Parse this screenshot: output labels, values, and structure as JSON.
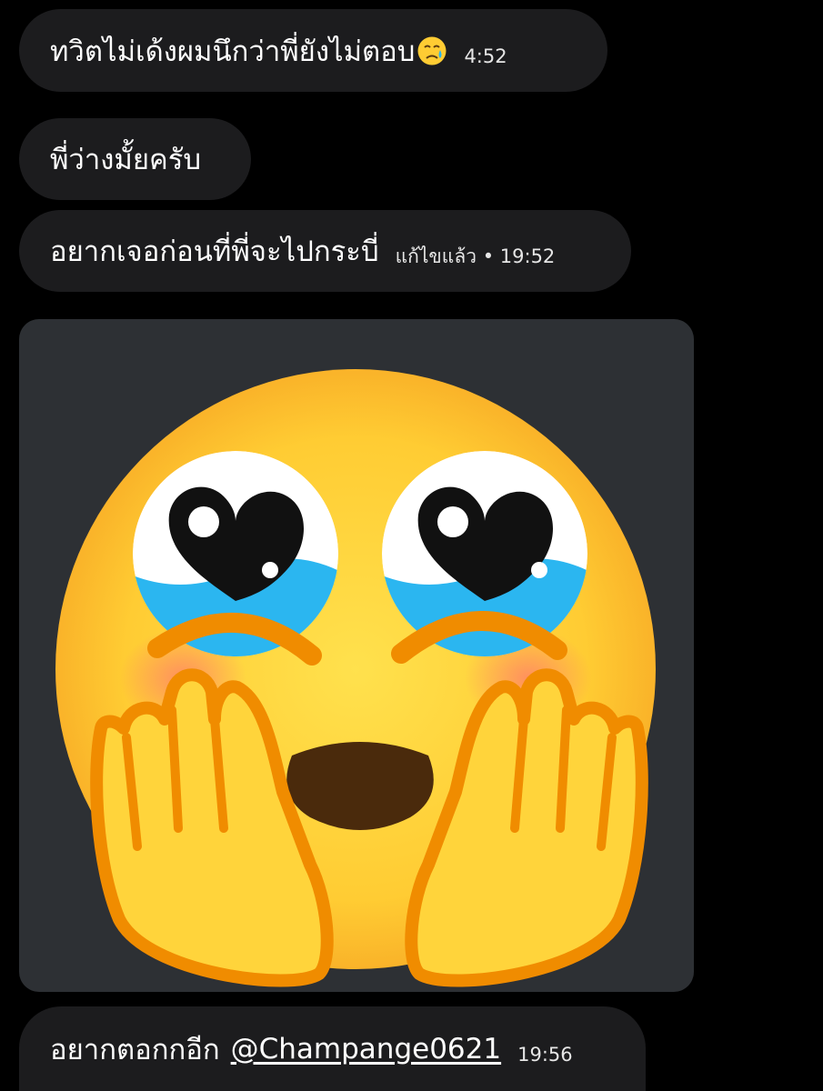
{
  "messages": [
    {
      "text": "ทวิตไม่เด้งผมนึกว่าพี่ยังไม่ตอบ",
      "emoji": "crying-face-icon",
      "time": "4:52"
    },
    {
      "text": "พี่ว่างมั้ยครับ"
    },
    {
      "text": "อยากเจอก่อนที่พี่จะไปกระบี่",
      "edited_label": "แก้ไขแล้ว",
      "separator": "•",
      "time": "19:52"
    },
    {
      "sticker": "face-holding-back-tears-hands-icon"
    },
    {
      "text": "อยากตอกกอีก",
      "mention": "@Champange0621",
      "time": "19:56"
    }
  ],
  "colors": {
    "background": "#000000",
    "bubble": "#1c1c1e",
    "sticker_card": "#2d3034",
    "emoji_face": "#ffcc33",
    "tears": "#2bb6f0"
  }
}
